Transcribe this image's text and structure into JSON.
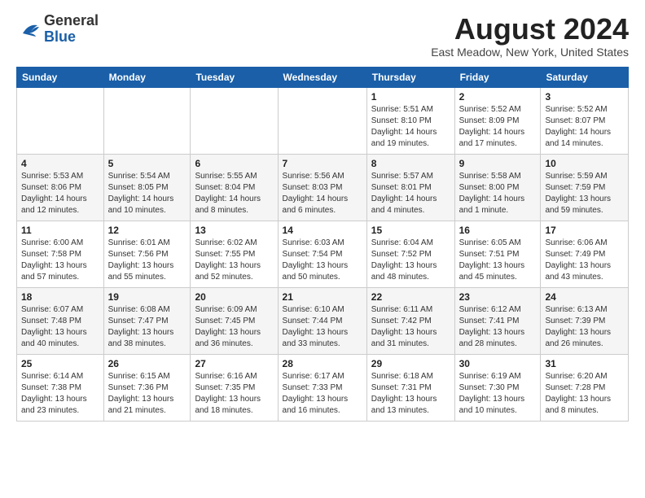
{
  "header": {
    "logo": {
      "general": "General",
      "blue": "Blue"
    },
    "title": "August 2024",
    "location": "East Meadow, New York, United States"
  },
  "days_of_week": [
    "Sunday",
    "Monday",
    "Tuesday",
    "Wednesday",
    "Thursday",
    "Friday",
    "Saturday"
  ],
  "weeks": [
    [
      {
        "day": "",
        "info": ""
      },
      {
        "day": "",
        "info": ""
      },
      {
        "day": "",
        "info": ""
      },
      {
        "day": "",
        "info": ""
      },
      {
        "day": "1",
        "info": "Sunrise: 5:51 AM\nSunset: 8:10 PM\nDaylight: 14 hours\nand 19 minutes."
      },
      {
        "day": "2",
        "info": "Sunrise: 5:52 AM\nSunset: 8:09 PM\nDaylight: 14 hours\nand 17 minutes."
      },
      {
        "day": "3",
        "info": "Sunrise: 5:52 AM\nSunset: 8:07 PM\nDaylight: 14 hours\nand 14 minutes."
      }
    ],
    [
      {
        "day": "4",
        "info": "Sunrise: 5:53 AM\nSunset: 8:06 PM\nDaylight: 14 hours\nand 12 minutes."
      },
      {
        "day": "5",
        "info": "Sunrise: 5:54 AM\nSunset: 8:05 PM\nDaylight: 14 hours\nand 10 minutes."
      },
      {
        "day": "6",
        "info": "Sunrise: 5:55 AM\nSunset: 8:04 PM\nDaylight: 14 hours\nand 8 minutes."
      },
      {
        "day": "7",
        "info": "Sunrise: 5:56 AM\nSunset: 8:03 PM\nDaylight: 14 hours\nand 6 minutes."
      },
      {
        "day": "8",
        "info": "Sunrise: 5:57 AM\nSunset: 8:01 PM\nDaylight: 14 hours\nand 4 minutes."
      },
      {
        "day": "9",
        "info": "Sunrise: 5:58 AM\nSunset: 8:00 PM\nDaylight: 14 hours\nand 1 minute."
      },
      {
        "day": "10",
        "info": "Sunrise: 5:59 AM\nSunset: 7:59 PM\nDaylight: 13 hours\nand 59 minutes."
      }
    ],
    [
      {
        "day": "11",
        "info": "Sunrise: 6:00 AM\nSunset: 7:58 PM\nDaylight: 13 hours\nand 57 minutes."
      },
      {
        "day": "12",
        "info": "Sunrise: 6:01 AM\nSunset: 7:56 PM\nDaylight: 13 hours\nand 55 minutes."
      },
      {
        "day": "13",
        "info": "Sunrise: 6:02 AM\nSunset: 7:55 PM\nDaylight: 13 hours\nand 52 minutes."
      },
      {
        "day": "14",
        "info": "Sunrise: 6:03 AM\nSunset: 7:54 PM\nDaylight: 13 hours\nand 50 minutes."
      },
      {
        "day": "15",
        "info": "Sunrise: 6:04 AM\nSunset: 7:52 PM\nDaylight: 13 hours\nand 48 minutes."
      },
      {
        "day": "16",
        "info": "Sunrise: 6:05 AM\nSunset: 7:51 PM\nDaylight: 13 hours\nand 45 minutes."
      },
      {
        "day": "17",
        "info": "Sunrise: 6:06 AM\nSunset: 7:49 PM\nDaylight: 13 hours\nand 43 minutes."
      }
    ],
    [
      {
        "day": "18",
        "info": "Sunrise: 6:07 AM\nSunset: 7:48 PM\nDaylight: 13 hours\nand 40 minutes."
      },
      {
        "day": "19",
        "info": "Sunrise: 6:08 AM\nSunset: 7:47 PM\nDaylight: 13 hours\nand 38 minutes."
      },
      {
        "day": "20",
        "info": "Sunrise: 6:09 AM\nSunset: 7:45 PM\nDaylight: 13 hours\nand 36 minutes."
      },
      {
        "day": "21",
        "info": "Sunrise: 6:10 AM\nSunset: 7:44 PM\nDaylight: 13 hours\nand 33 minutes."
      },
      {
        "day": "22",
        "info": "Sunrise: 6:11 AM\nSunset: 7:42 PM\nDaylight: 13 hours\nand 31 minutes."
      },
      {
        "day": "23",
        "info": "Sunrise: 6:12 AM\nSunset: 7:41 PM\nDaylight: 13 hours\nand 28 minutes."
      },
      {
        "day": "24",
        "info": "Sunrise: 6:13 AM\nSunset: 7:39 PM\nDaylight: 13 hours\nand 26 minutes."
      }
    ],
    [
      {
        "day": "25",
        "info": "Sunrise: 6:14 AM\nSunset: 7:38 PM\nDaylight: 13 hours\nand 23 minutes."
      },
      {
        "day": "26",
        "info": "Sunrise: 6:15 AM\nSunset: 7:36 PM\nDaylight: 13 hours\nand 21 minutes."
      },
      {
        "day": "27",
        "info": "Sunrise: 6:16 AM\nSunset: 7:35 PM\nDaylight: 13 hours\nand 18 minutes."
      },
      {
        "day": "28",
        "info": "Sunrise: 6:17 AM\nSunset: 7:33 PM\nDaylight: 13 hours\nand 16 minutes."
      },
      {
        "day": "29",
        "info": "Sunrise: 6:18 AM\nSunset: 7:31 PM\nDaylight: 13 hours\nand 13 minutes."
      },
      {
        "day": "30",
        "info": "Sunrise: 6:19 AM\nSunset: 7:30 PM\nDaylight: 13 hours\nand 10 minutes."
      },
      {
        "day": "31",
        "info": "Sunrise: 6:20 AM\nSunset: 7:28 PM\nDaylight: 13 hours\nand 8 minutes."
      }
    ]
  ]
}
